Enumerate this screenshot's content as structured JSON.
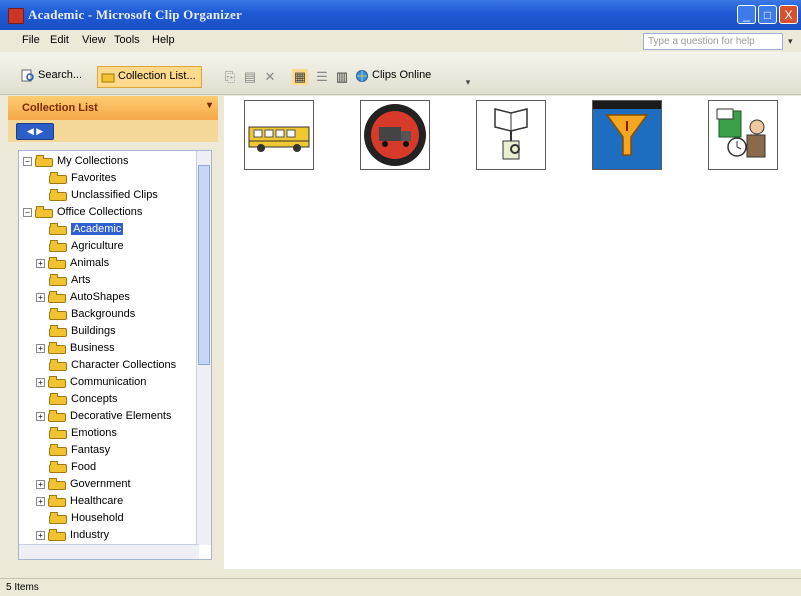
{
  "window": {
    "title": "Academic - Microsoft Clip Organizer",
    "minimize_glyph": "_",
    "maximize_glyph": "□",
    "close_glyph": "X"
  },
  "menu": [
    "File",
    "Edit",
    "View",
    "Tools",
    "Help"
  ],
  "help_box": {
    "placeholder": "Type a question for help"
  },
  "toolbar": {
    "search_label": "Search...",
    "collection_list_label": "Collection List...",
    "clips_online_label": "Clips Online"
  },
  "pane": {
    "header": "Collection List"
  },
  "tree": {
    "my_collections": "My Collections",
    "favorites": "Favorites",
    "unclassified": "Unclassified Clips",
    "office_collections": "Office Collections",
    "items": [
      "Academic",
      "Agriculture",
      "Animals",
      "Arts",
      "AutoShapes",
      "Backgrounds",
      "Buildings",
      "Business",
      "Character Collections",
      "Communication",
      "Concepts",
      "Decorative Elements",
      "Emotions",
      "Fantasy",
      "Food",
      "Government",
      "Healthcare",
      "Household",
      "Industry"
    ],
    "selected": "Academic"
  },
  "clips": [
    "school-bus",
    "truck-circle",
    "book-stethoscope",
    "funnel",
    "person-clock"
  ],
  "status": {
    "text": "5 Items"
  }
}
